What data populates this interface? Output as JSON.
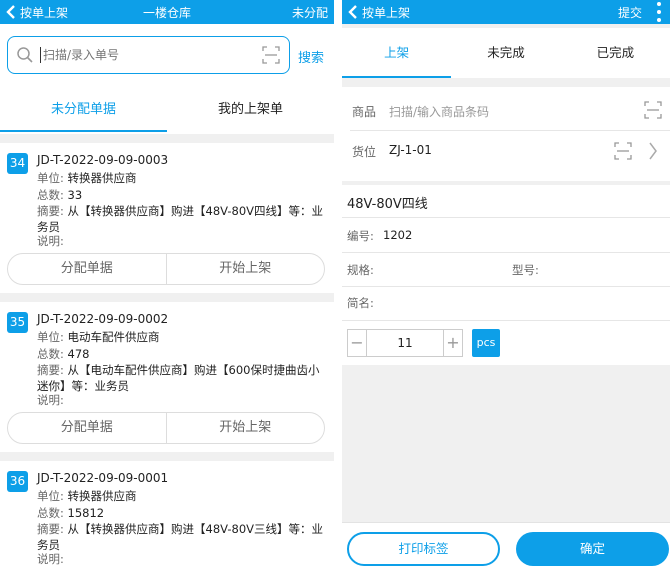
{
  "left": {
    "topbar": {
      "back_label": "按单上架",
      "title": "一楼仓库",
      "action": "未分配"
    },
    "search": {
      "placeholder": "扫描/录入单号",
      "button": "搜索"
    },
    "tabs": [
      "未分配单据",
      "我的上架单"
    ],
    "labels": {
      "unit": "单位:",
      "total": "总数:",
      "memo": "摘要:",
      "note": "说明:"
    },
    "orders": [
      {
        "index": "34",
        "doc_no": "JD-T-2022-09-09-0003",
        "unit": "转换器供应商",
        "total": "33",
        "memo": "从【转换器供应商】购进【48V-80V四线】等：业务员",
        "note": "",
        "btn_assign": "分配单据",
        "btn_start": "开始上架"
      },
      {
        "index": "35",
        "doc_no": "JD-T-2022-09-09-0002",
        "unit": "电动车配件供应商",
        "total": "478",
        "memo": "从【电动车配件供应商】购进【600保时捷曲齿小迷你】等：业务员",
        "note": "",
        "btn_assign": "分配单据",
        "btn_start": "开始上架"
      },
      {
        "index": "36",
        "doc_no": "JD-T-2022-09-09-0001",
        "unit": "转换器供应商",
        "total": "15812",
        "memo": "从【转换器供应商】购进【48V-80V三线】等：业务员",
        "note": "",
        "btn_assign": "",
        "btn_start": ""
      }
    ]
  },
  "right": {
    "topbar": {
      "back_label": "按单上架",
      "action": "提交"
    },
    "tabs": [
      "上架",
      "未完成",
      "已完成"
    ],
    "product": {
      "label": "商品",
      "placeholder": "扫描/输入商品条码"
    },
    "location": {
      "label": "货位",
      "value": "ZJ-1-01"
    },
    "item": {
      "name": "48V-80V四线",
      "code_label": "编号:",
      "code": "1202",
      "spec_label": "规格:",
      "spec": "",
      "model_label": "型号:",
      "model": "",
      "short_label": "简名:",
      "short": ""
    },
    "qty": {
      "value": "11",
      "unit": "pcs",
      "minus": "−",
      "plus": "+"
    },
    "buttons": {
      "print": "打印标签",
      "confirm": "确定"
    }
  },
  "colors": {
    "accent": "#0d9fe8",
    "background": "#f0f0f0"
  }
}
